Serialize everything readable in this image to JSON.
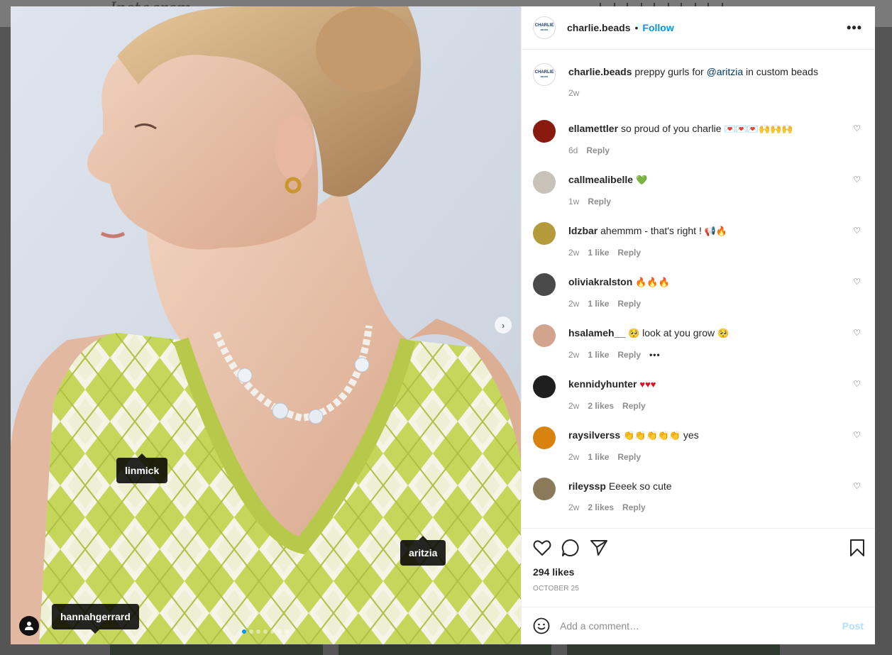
{
  "background": {
    "logo_text": "Instagram"
  },
  "media": {
    "tags": [
      {
        "label": "linmick"
      },
      {
        "label": "aritzia"
      },
      {
        "label": "hannahgerrard"
      }
    ],
    "carousel_index": 1,
    "carousel_count": 7
  },
  "header": {
    "logo_line1": "CHARLIE",
    "logo_line2": "BEADS",
    "username": "charlie.beads",
    "separator": "•",
    "follow_label": "Follow",
    "more_label": "•••"
  },
  "caption": {
    "username": "charlie.beads",
    "text_before": "preppy gurls for ",
    "mention": "@aritzia",
    "text_after": " in custom beads",
    "time": "2w"
  },
  "comments": [
    {
      "username": "ellamettler",
      "text": "so proud of you charlie",
      "emoji": "💌💌💌🙌🙌🙌",
      "time": "6d",
      "likes": "",
      "reply": "Reply",
      "avatar_color": "#8a1a0e"
    },
    {
      "username": "callmealibelle",
      "text": "",
      "emoji": "💚",
      "time": "1w",
      "likes": "",
      "reply": "Reply",
      "avatar_color": "#c9c2b8"
    },
    {
      "username": "ldzbar",
      "text": "ahemmm - that's right !",
      "emoji": "📢🔥",
      "time": "2w",
      "likes": "1 like",
      "reply": "Reply",
      "avatar_color": "#b59a3c"
    },
    {
      "username": "oliviakralston",
      "text": "",
      "emoji": "🔥🔥🔥",
      "time": "2w",
      "likes": "1 like",
      "reply": "Reply",
      "avatar_color": "#4a4a4a"
    },
    {
      "username": "hsalameh__",
      "text": "look at you grow",
      "emoji": "🥺",
      "time": "2w",
      "likes": "1 like",
      "reply": "Reply",
      "avatar_color": "#d2a48e"
    },
    {
      "username": "kennidyhunter",
      "text": "",
      "emoji": "♥♥♥",
      "time": "2w",
      "likes": "2 likes",
      "reply": "Reply",
      "avatar_color": "#1f1f1f"
    },
    {
      "username": "raysilverss",
      "text": "yes",
      "emoji": "👏👏👏👏👏",
      "time": "2w",
      "likes": "1 like",
      "reply": "Reply",
      "avatar_color": "#d9820f"
    },
    {
      "username": "rileyssp",
      "text": "Eeeek so cute",
      "emoji": "",
      "time": "2w",
      "likes": "2 likes",
      "reply": "Reply",
      "avatar_color": "#8a7a5a"
    }
  ],
  "hsalameh_more": "•••",
  "actions": {
    "likes_count": "294 likes",
    "date": "OCTOBER 25"
  },
  "comment_box": {
    "placeholder": "Add a comment…",
    "post_label": "Post"
  },
  "colors": {
    "accent": "#0095f6",
    "post_disabled": "#b2dffc",
    "sweater_green": "#c5d75a"
  }
}
